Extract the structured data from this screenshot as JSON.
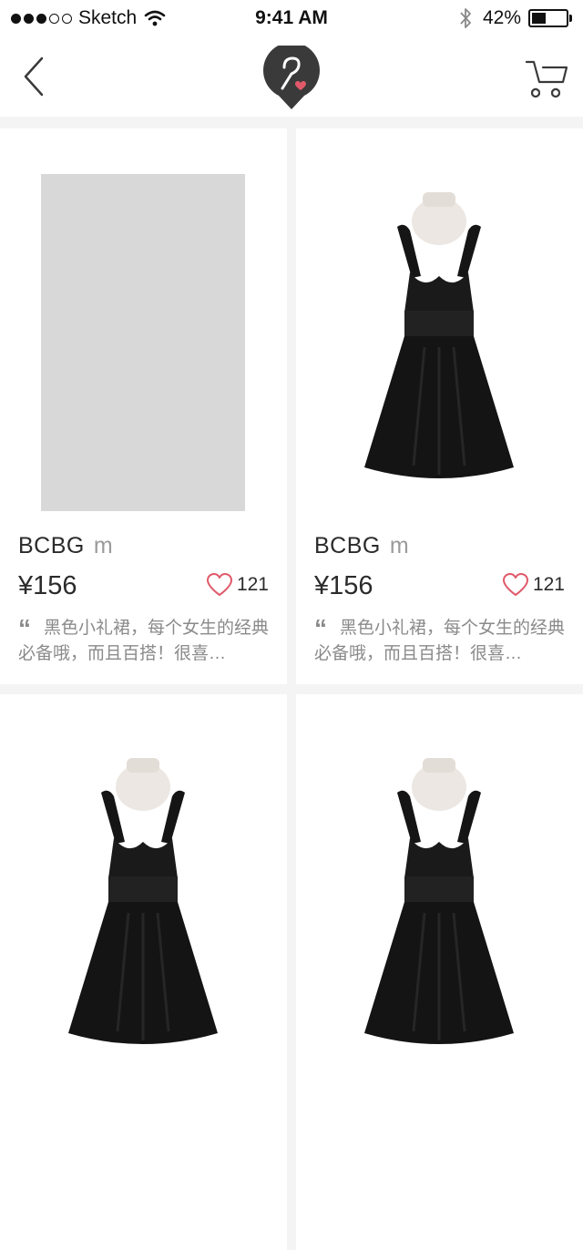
{
  "status_bar": {
    "carrier": "Sketch",
    "time": "9:41 AM",
    "battery": "42%",
    "battery_level": 0.42
  },
  "nav": {
    "back_icon": "chevron-left-icon",
    "logo_icon": "hanger-heart-logo",
    "cart_icon": "shopping-cart-icon"
  },
  "colors": {
    "heart": "#e05a6a",
    "logo_bg": "#3a3a3a",
    "placeholder": "#d8d8d8"
  },
  "products": [
    {
      "image": "placeholder",
      "brand": "BCBG",
      "size": "m",
      "price": "¥156",
      "likes": "121",
      "desc": "黑色小礼裙，每个女生的经典必备哦，而且百搭！很喜…"
    },
    {
      "image": "black-dress",
      "brand": "BCBG",
      "size": "m",
      "price": "¥156",
      "likes": "121",
      "desc": "黑色小礼裙，每个女生的经典必备哦，而且百搭！很喜…"
    },
    {
      "image": "black-dress",
      "brand": "",
      "size": "",
      "price": "",
      "likes": "",
      "desc": ""
    },
    {
      "image": "black-dress",
      "brand": "",
      "size": "",
      "price": "",
      "likes": "",
      "desc": ""
    }
  ]
}
